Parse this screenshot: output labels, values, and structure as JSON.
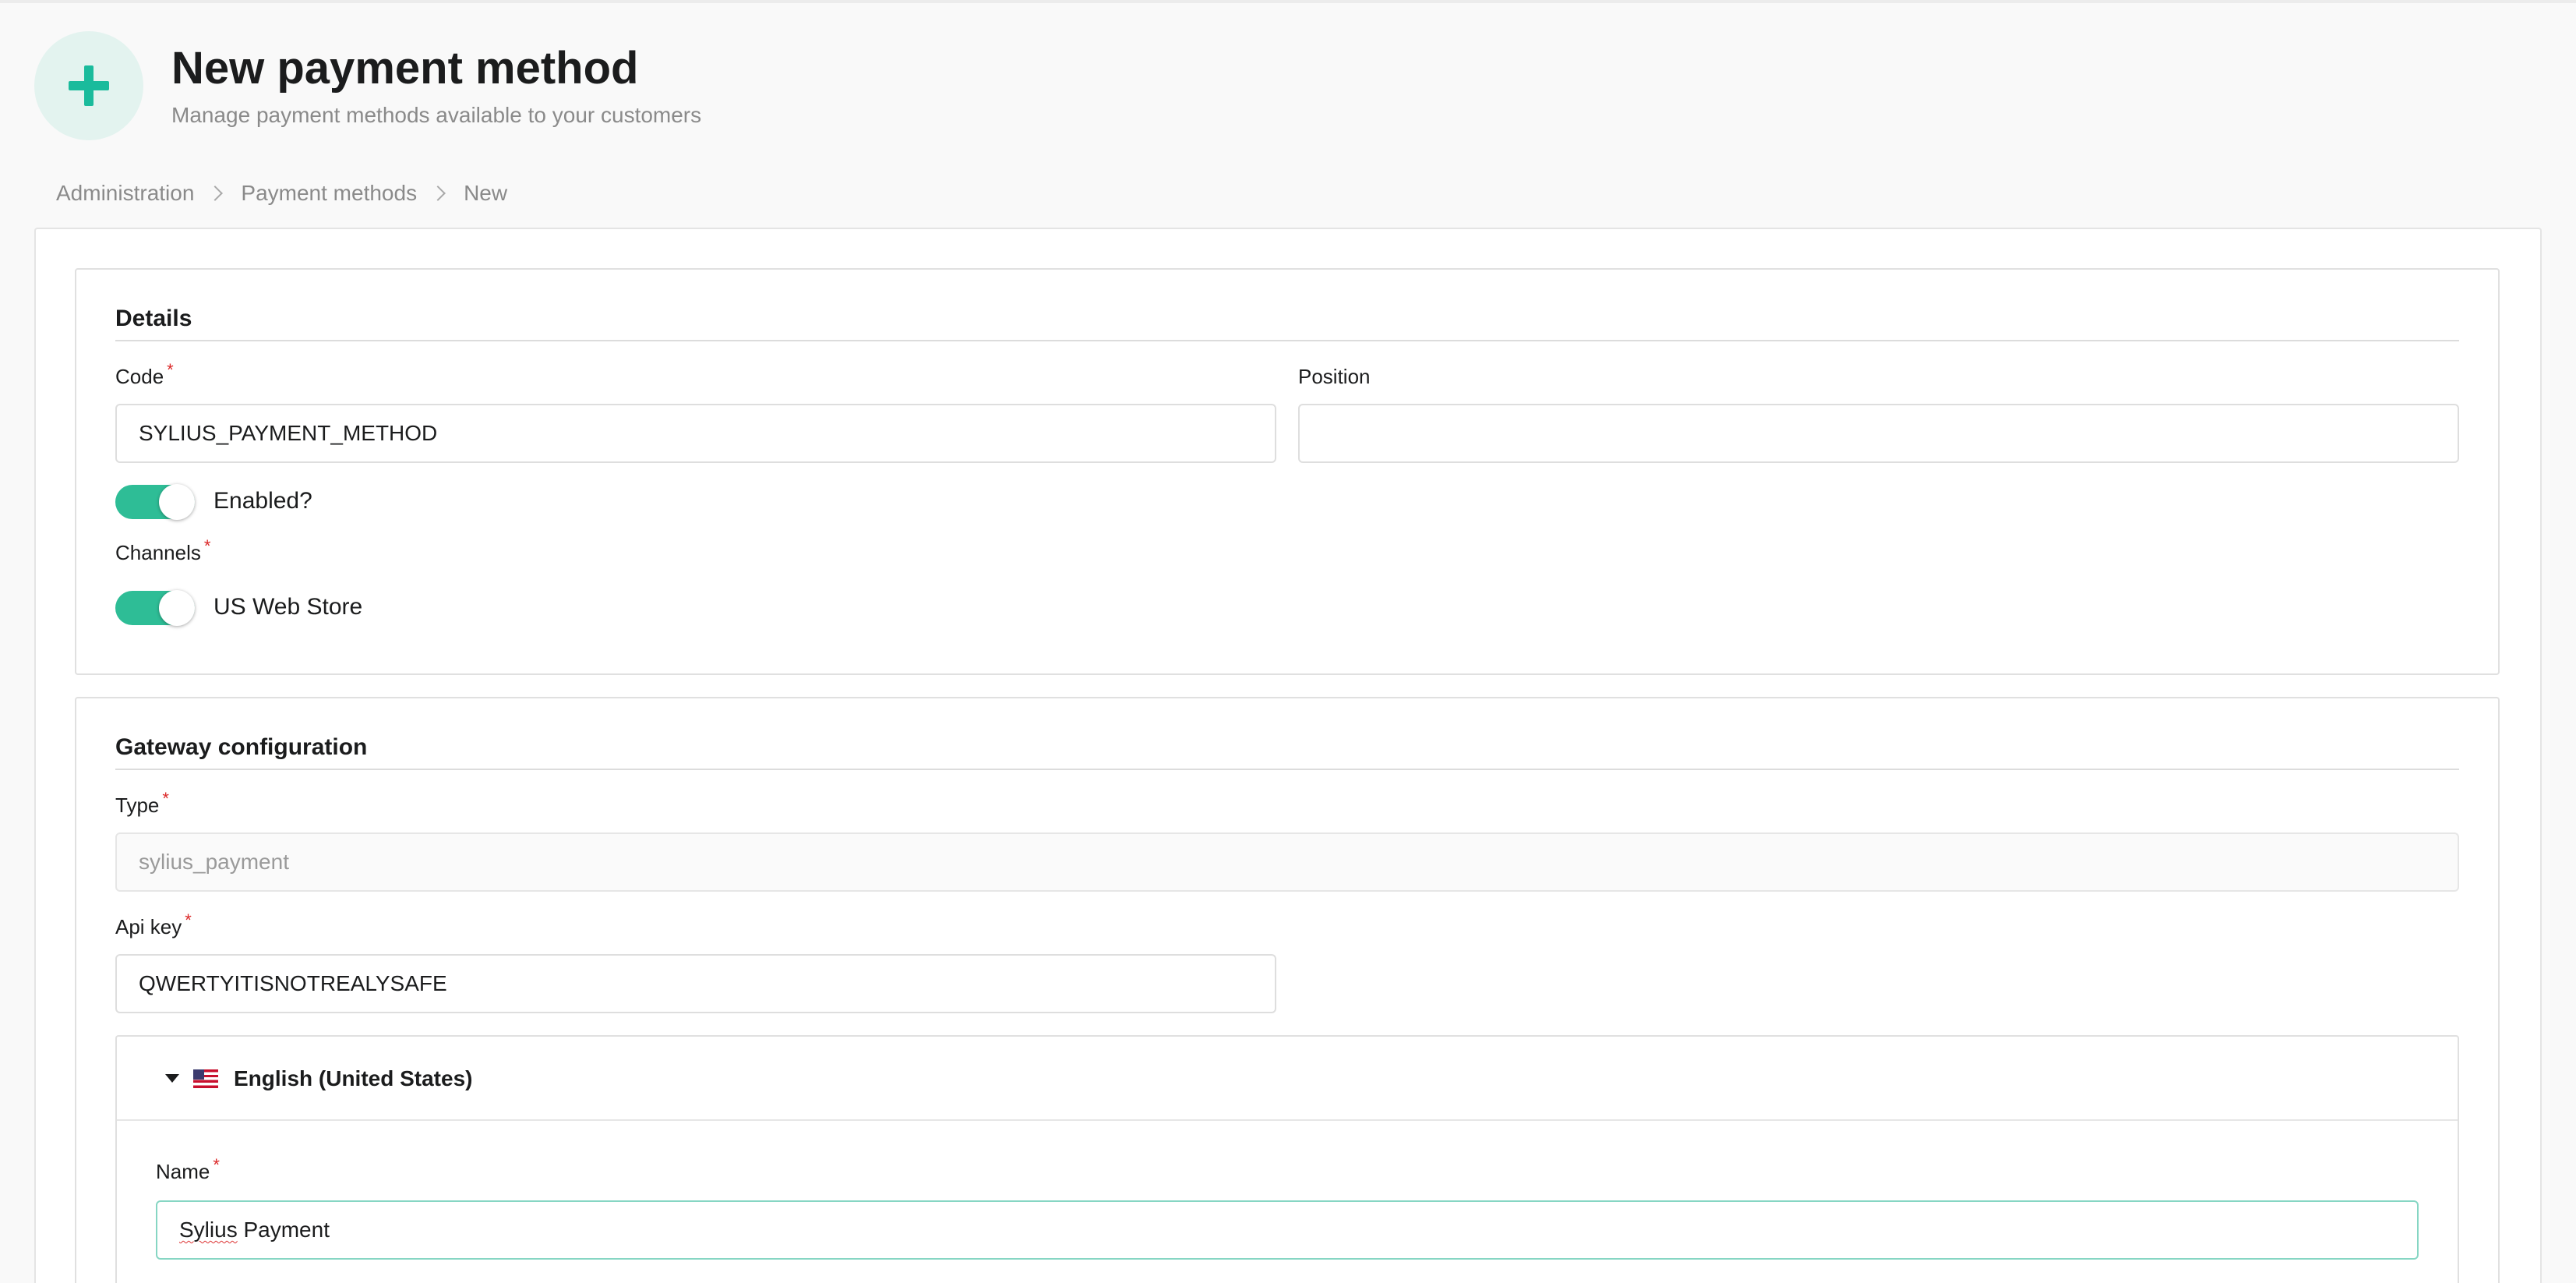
{
  "header": {
    "icon": "plus-icon",
    "title": "New payment method",
    "subtitle": "Manage payment methods available to your customers"
  },
  "breadcrumb": [
    {
      "label": "Administration"
    },
    {
      "label": "Payment methods"
    },
    {
      "label": "New"
    }
  ],
  "details": {
    "section_title": "Details",
    "code": {
      "label": "Code",
      "value": "SYLIUS_PAYMENT_METHOD",
      "required": true
    },
    "position": {
      "label": "Position",
      "value": ""
    },
    "enabled": {
      "label": "Enabled?",
      "checked": true
    },
    "channels": {
      "label": "Channels",
      "required": true,
      "items": [
        {
          "label": "US Web Store",
          "checked": true
        }
      ]
    }
  },
  "gateway": {
    "section_title": "Gateway configuration",
    "type": {
      "label": "Type",
      "value": "sylius_payment",
      "required": true,
      "disabled": true
    },
    "api_key": {
      "label": "Api key",
      "value": "QWERTYITISNOTREALYSAFE",
      "required": true
    }
  },
  "translation": {
    "locale": "English (United States)",
    "flag_icon": "us-flag-icon",
    "name": {
      "label": "Name",
      "value_word1": "Sylius",
      "value_word2": " Payment",
      "required": true
    }
  },
  "colors": {
    "accent": "#2ebd96",
    "required_marker": "#db2828",
    "icon_bg": "#e3f3ef"
  }
}
